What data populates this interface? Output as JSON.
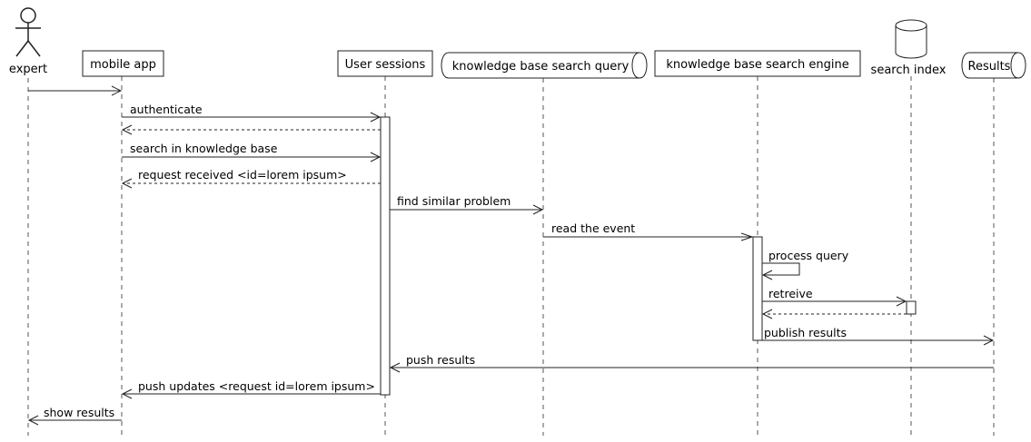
{
  "participants": [
    {
      "id": "expert",
      "label": "expert",
      "kind": "actor"
    },
    {
      "id": "mobile",
      "label": "mobile app",
      "kind": "participant"
    },
    {
      "id": "sessions",
      "label": "User sessions",
      "kind": "participant"
    },
    {
      "id": "query",
      "label": "knowledge base search query",
      "kind": "queue"
    },
    {
      "id": "engine",
      "label": "knowledge base search engine",
      "kind": "participant"
    },
    {
      "id": "index",
      "label": "search index",
      "kind": "database"
    },
    {
      "id": "results",
      "label": "Results",
      "kind": "queue"
    }
  ],
  "messages": [
    {
      "from": "expert",
      "to": "mobile",
      "label": "",
      "dashed": false
    },
    {
      "from": "mobile",
      "to": "sessions",
      "label": "authenticate",
      "dashed": false
    },
    {
      "from": "sessions",
      "to": "mobile",
      "label": "",
      "dashed": true
    },
    {
      "from": "mobile",
      "to": "sessions",
      "label": "search in knowledge base",
      "dashed": false
    },
    {
      "from": "sessions",
      "to": "mobile",
      "label": "request received <id=lorem ipsum>",
      "dashed": true
    },
    {
      "from": "sessions",
      "to": "query",
      "label": "find similar problem",
      "dashed": false
    },
    {
      "from": "query",
      "to": "engine",
      "label": "read the event",
      "dashed": false
    },
    {
      "from": "engine",
      "to": "engine",
      "label": "process query",
      "dashed": false
    },
    {
      "from": "engine",
      "to": "index",
      "label": "retreive",
      "dashed": false
    },
    {
      "from": "index",
      "to": "engine",
      "label": "",
      "dashed": true
    },
    {
      "from": "engine",
      "to": "results",
      "label": "publish results",
      "dashed": false
    },
    {
      "from": "results",
      "to": "sessions",
      "label": "push results",
      "dashed": false
    },
    {
      "from": "sessions",
      "to": "mobile",
      "label": "push updates <request id=lorem ipsum>",
      "dashed": false
    },
    {
      "from": "mobile",
      "to": "expert",
      "label": "show results",
      "dashed": false
    }
  ]
}
